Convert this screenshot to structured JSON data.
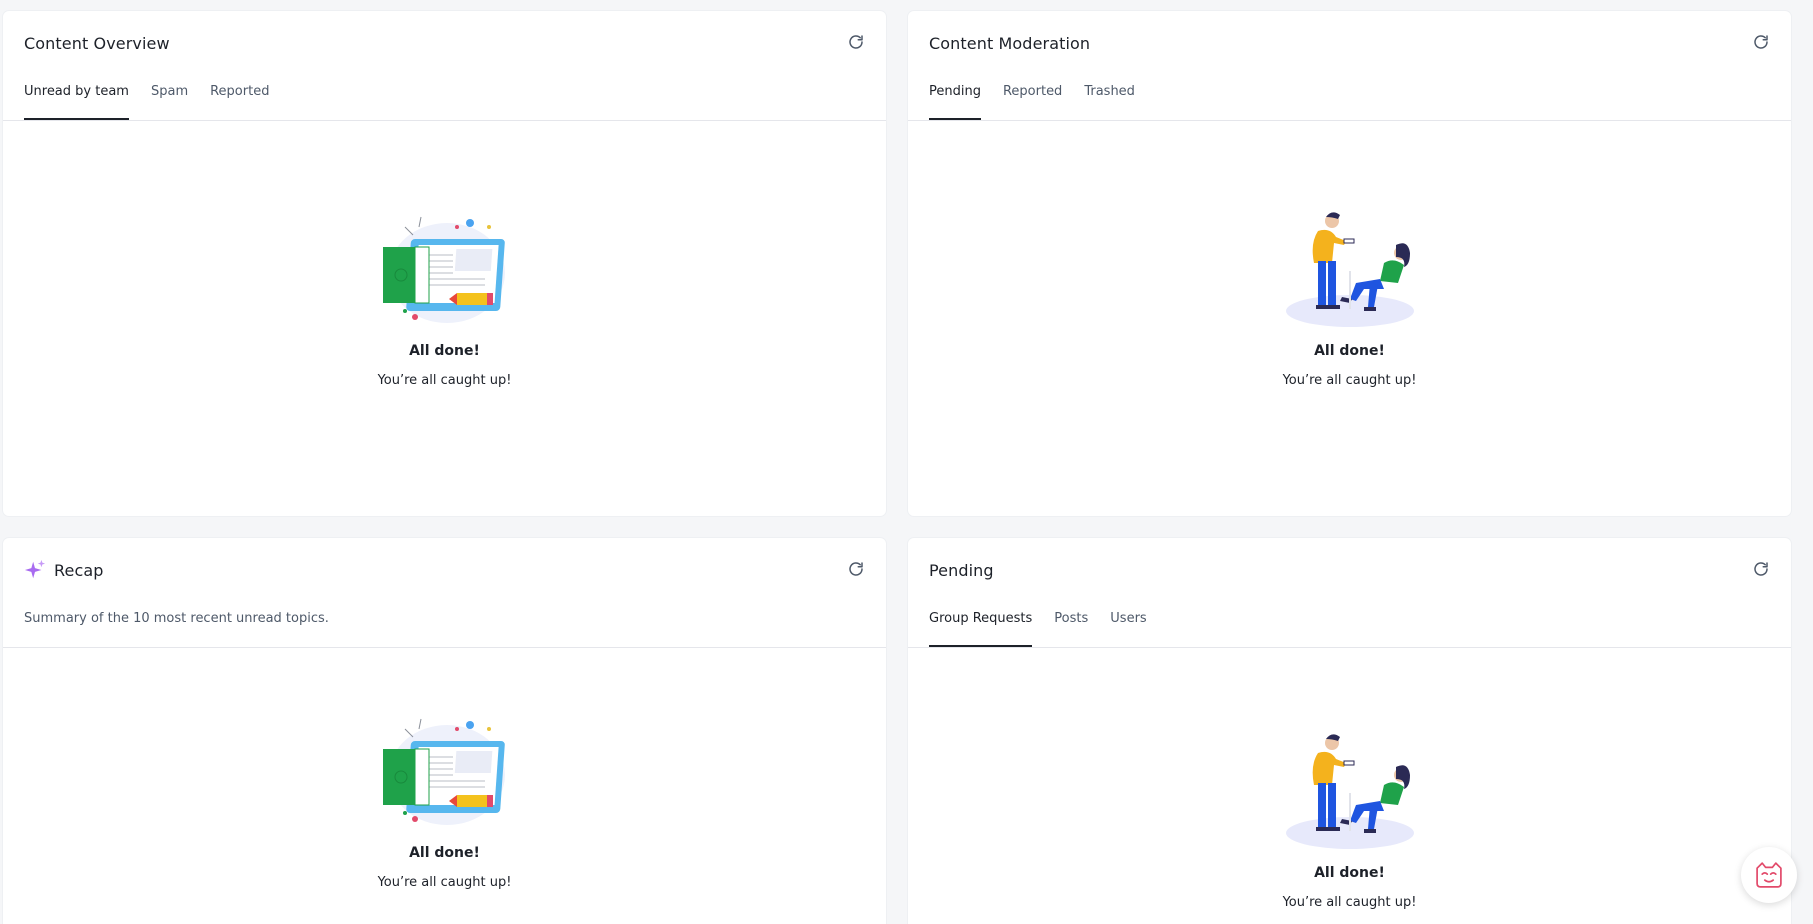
{
  "cards": {
    "content_overview": {
      "title": "Content Overview",
      "tabs": [
        "Unread by team",
        "Spam",
        "Reported"
      ],
      "active_tab": "Unread by team",
      "empty_title": "All done!",
      "empty_subtitle": "You’re all caught up!",
      "refresh_icon": "refresh-icon"
    },
    "content_moderation": {
      "title": "Content Moderation",
      "tabs": [
        "Pending",
        "Reported",
        "Trashed"
      ],
      "active_tab": "Pending",
      "empty_title": "All done!",
      "empty_subtitle": "You’re all caught up!",
      "refresh_icon": "refresh-icon"
    },
    "recap": {
      "title": "Recap",
      "subtitle": "Summary of the 10 most recent unread topics.",
      "empty_title": "All done!",
      "empty_subtitle": "You’re all caught up!",
      "title_icon": "sparkle-icon",
      "refresh_icon": "refresh-icon"
    },
    "pending": {
      "title": "Pending",
      "tabs": [
        "Group Requests",
        "Posts",
        "Users"
      ],
      "active_tab": "Group Requests",
      "empty_title": "All done!",
      "empty_subtitle": "You’re all caught up!",
      "refresh_icon": "refresh-icon"
    }
  },
  "chat_widget": {
    "icon": "cat-face-icon"
  },
  "colors": {
    "background": "#f5f6f8",
    "card": "#ffffff",
    "text_primary": "#1d2129",
    "text_secondary": "#4e5969",
    "divider": "#e5e6eb",
    "sparkle": "#a86bf0"
  }
}
